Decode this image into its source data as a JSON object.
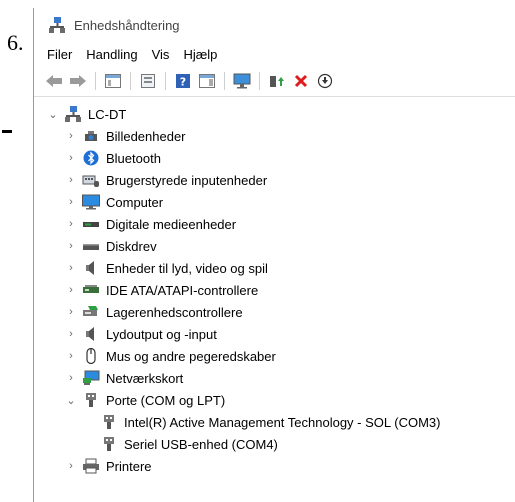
{
  "outside": {
    "step_number": "6."
  },
  "window": {
    "title": "Enhedshåndtering"
  },
  "menu": [
    "Filer",
    "Handling",
    "Vis",
    "Hjælp"
  ],
  "tree": {
    "root": "LC-DT",
    "categories": [
      {
        "label": "Billedenheder",
        "icon": "camera-icon"
      },
      {
        "label": "Bluetooth",
        "icon": "bluetooth-icon"
      },
      {
        "label": "Brugerstyrede inputenheder",
        "icon": "hid-icon"
      },
      {
        "label": "Computer",
        "icon": "monitor-icon"
      },
      {
        "label": "Digitale medieenheder",
        "icon": "media-device-icon"
      },
      {
        "label": "Diskdrev",
        "icon": "disk-drive-icon"
      },
      {
        "label": "Enheder til lyd, video og spil",
        "icon": "speaker-icon"
      },
      {
        "label": "IDE ATA/ATAPI-controllere",
        "icon": "ide-controller-icon"
      },
      {
        "label": "Lagerenhedscontrollere",
        "icon": "storage-controller-icon"
      },
      {
        "label": "Lydoutput og -input",
        "icon": "speaker-icon"
      },
      {
        "label": "Mus og andre pegeredskaber",
        "icon": "mouse-icon"
      },
      {
        "label": "Netværkskort",
        "icon": "network-icon"
      },
      {
        "label": "Porte (COM og LPT)",
        "icon": "port-icon",
        "expanded": true
      },
      {
        "label": "Printere",
        "icon": "printer-icon"
      }
    ],
    "port_children": [
      "Intel(R) Active Management Technology - SOL (COM3)",
      "Seriel USB-enhed (COM4)"
    ]
  }
}
